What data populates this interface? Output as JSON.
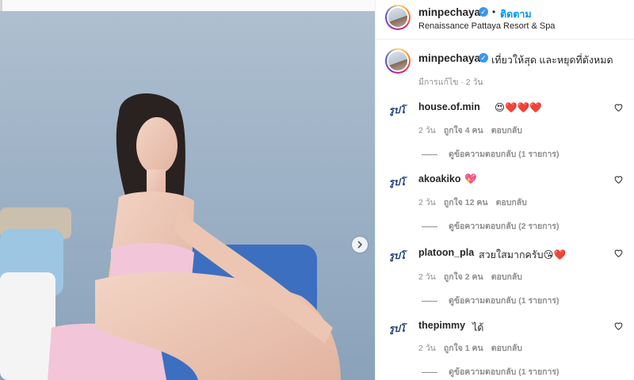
{
  "post": {
    "username": "minpechaya",
    "follow_label": "ติดตาม",
    "dot": "•",
    "location": "Renaissance Pattaya Resort & Spa"
  },
  "caption": {
    "username": "minpechaya",
    "text": "เที่ยวให้สุด และหยุดที่ตังหมด",
    "edited": "มีการแก้ไข · 2 วัน"
  },
  "comments": [
    {
      "avatar": "รูปโ",
      "username": "house.of.min",
      "text": "😍❤️❤️❤️",
      "time": "2 วัน",
      "likes": "ถูกใจ 4 คน",
      "reply": "ตอบกลับ",
      "view_replies": "ดูข้อความตอบกลับ (1 รายการ)"
    },
    {
      "avatar": "รูปโ",
      "username": "akoakiko",
      "text": "💖",
      "time": "2 วัน",
      "likes": "ถูกใจ 12 คน",
      "reply": "ตอบกลับ",
      "view_replies": "ดูข้อความตอบกลับ (2 รายการ)"
    },
    {
      "avatar": "รูปโ",
      "username": "platoon_pla",
      "text": "สวยใสมากครับ😘❤️",
      "time": "2 วัน",
      "likes": "ถูกใจ 2 คน",
      "reply": "ตอบกลับ",
      "view_replies": "ดูข้อความตอบกลับ (1 รายการ)"
    },
    {
      "avatar": "รูปโ",
      "username": "thepimmy",
      "text": "ได้",
      "time": "2 วัน",
      "likes": "ถูกใจ 1 คน",
      "reply": "ตอบกลับ",
      "view_replies": "ดูข้อความตอบกลับ (1 รายการ)"
    }
  ],
  "colors": {
    "accent": "#0095f6",
    "verified": "#3897f0",
    "muted": "#8e8e8e"
  },
  "icons": {
    "next": "chevron-right-icon",
    "like": "heart-outline-icon",
    "verified": "verified-badge-icon"
  }
}
